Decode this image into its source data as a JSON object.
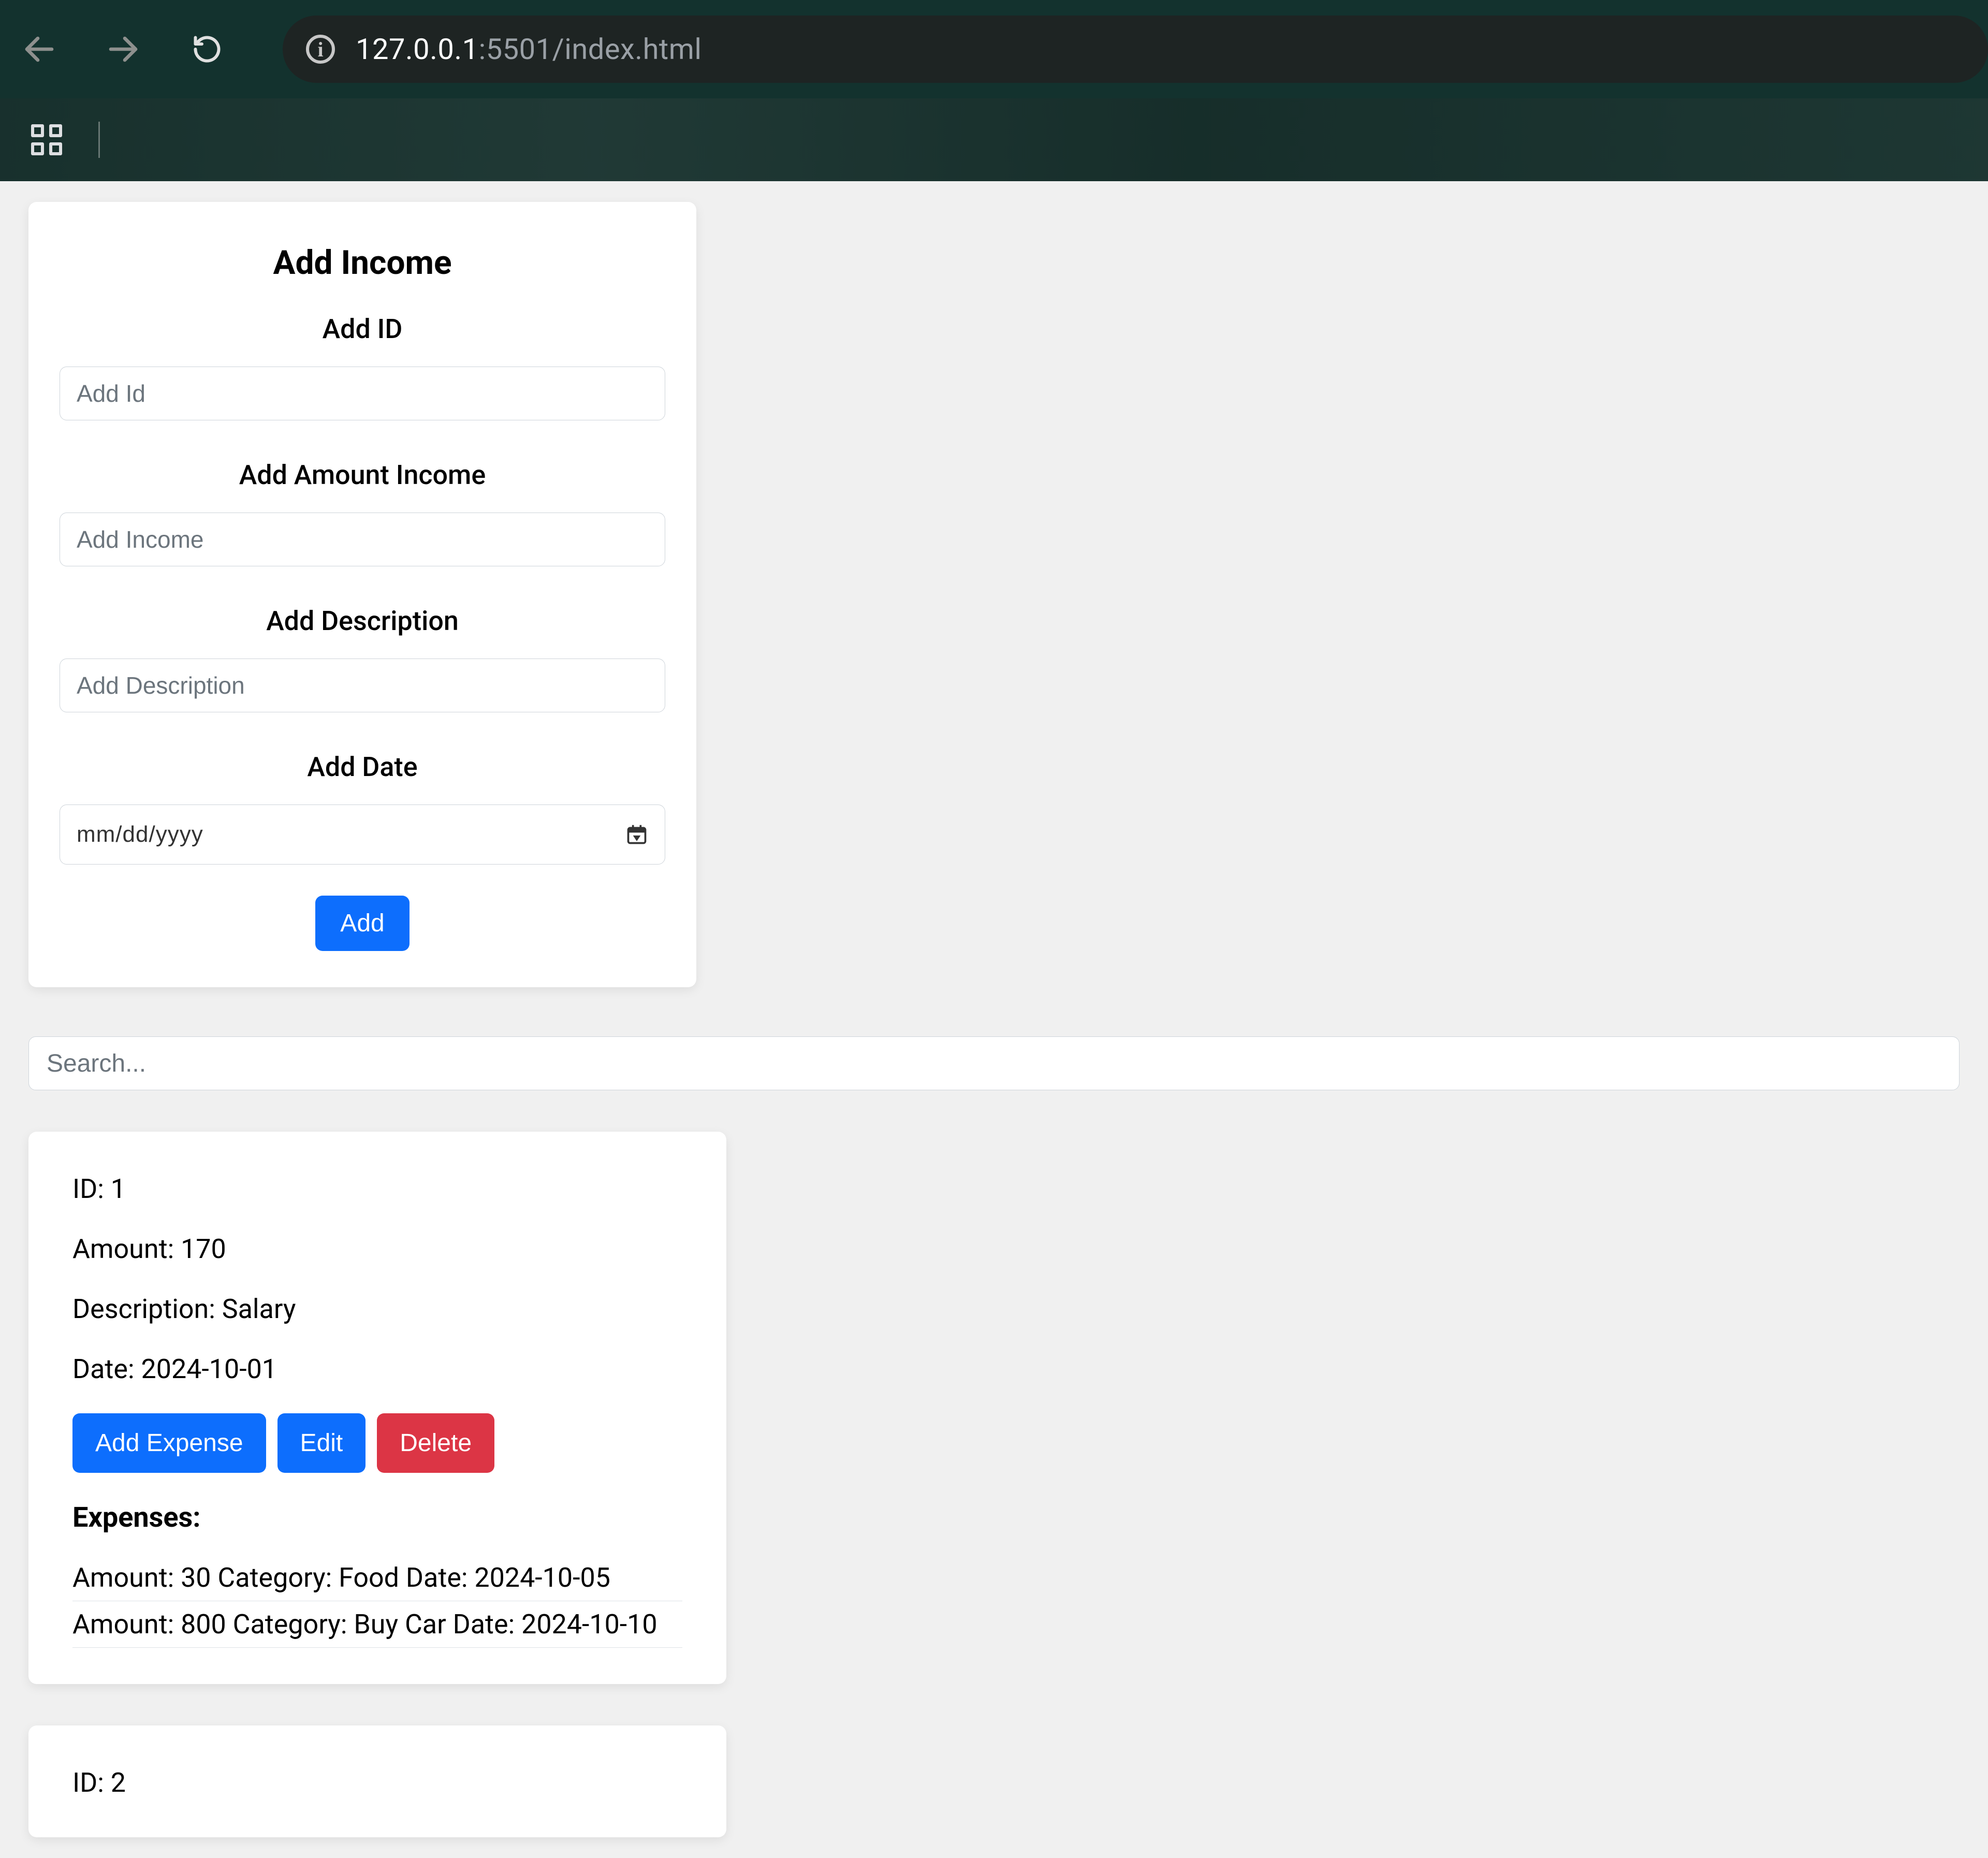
{
  "browser": {
    "url_prefix": "127.0.0.1",
    "url_suffix": ":5501/index.html",
    "info_glyph": "i"
  },
  "form": {
    "title": "Add Income",
    "id_label": "Add ID",
    "id_placeholder": "Add Id",
    "amount_label": "Add Amount Income",
    "amount_placeholder": "Add Income",
    "desc_label": "Add Description",
    "desc_placeholder": "Add Description",
    "date_label": "Add Date",
    "date_placeholder": "mm/dd/yyyy",
    "submit_label": "Add"
  },
  "search": {
    "placeholder": "Search..."
  },
  "records": [
    {
      "id_line": "ID: 1",
      "amount_line": "Amount: 170",
      "desc_line": "Description: Salary",
      "date_line": "Date: 2024-10-01",
      "buttons": {
        "add_expense": "Add Expense",
        "edit": "Edit",
        "delete": "Delete"
      },
      "expenses_title": "Expenses:",
      "expenses": [
        "Amount: 30 Category: Food Date: 2024-10-05",
        "Amount: 800 Category: Buy Car Date: 2024-10-10"
      ]
    },
    {
      "id_line": "ID: 2"
    }
  ],
  "colors": {
    "primary": "#0d6efd",
    "danger": "#dc3545",
    "chrome_bg": "#13322e"
  }
}
